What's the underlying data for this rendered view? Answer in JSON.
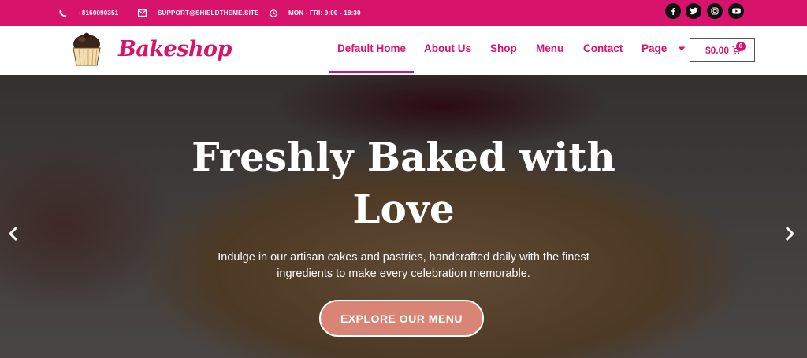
{
  "topbar": {
    "phone": "+8160090351",
    "email": "SUPPORT@SHIELDTHEME.SITE",
    "hours": "MON - FRI: 9:00 - 18:30",
    "socials": [
      "facebook-icon",
      "twitter-icon",
      "instagram-icon",
      "youtube-icon"
    ]
  },
  "brand": {
    "name": "Bakeshop"
  },
  "nav": {
    "items": [
      "Default Home",
      "About Us",
      "Shop",
      "Menu",
      "Contact",
      "Page"
    ],
    "active": "Default Home"
  },
  "cart": {
    "total": "$0.00",
    "count": "0"
  },
  "hero": {
    "title_line1": "Freshly Baked with",
    "title_line2": "Love",
    "subtitle_line1": "Indulge in our artisan cakes and pastries, handcrafted daily with the finest",
    "subtitle_line2": "ingredients to make every celebration memorable.",
    "button": "EXPLORE OUR MENU"
  },
  "colors": {
    "brand": "#d7136b",
    "button": "#d98576",
    "topbar_text": "#ffffff"
  }
}
